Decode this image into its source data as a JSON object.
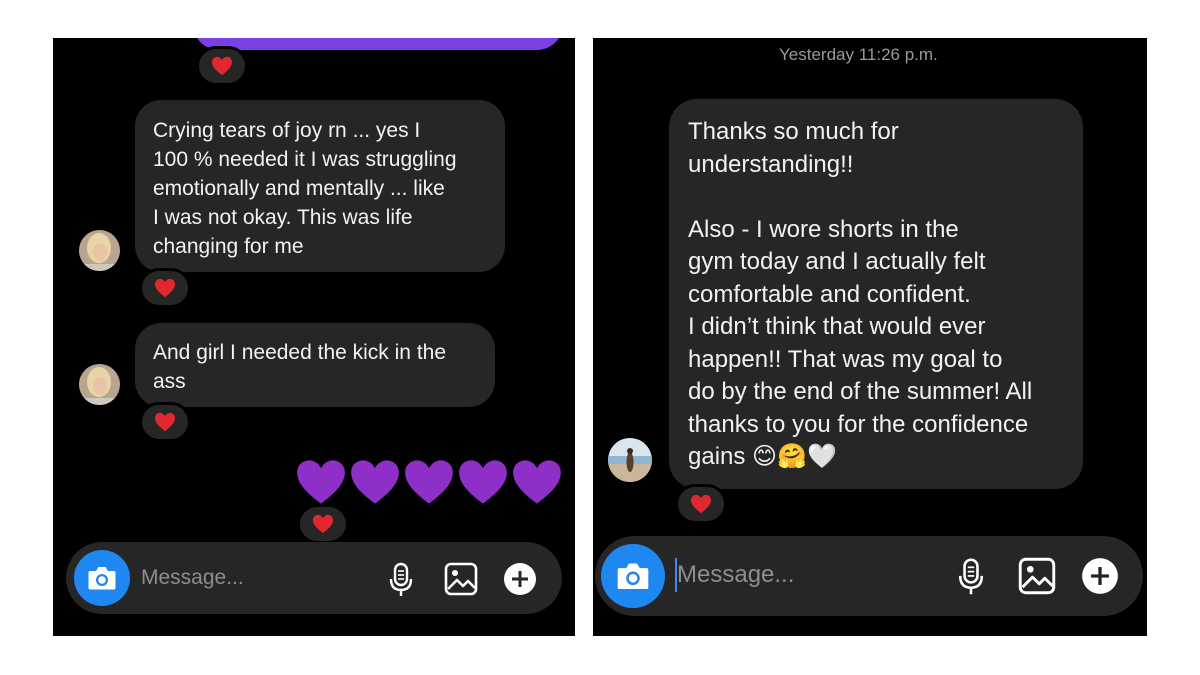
{
  "left": {
    "messages": [
      {
        "text": "Crying tears of joy rn ... yes I\n100 % needed it I was struggling\nemotionally and mentally ... like\nI was not okay. This was life\nchanging for me"
      },
      {
        "text": "And girl I needed the kick in the\nass"
      }
    ],
    "composer": {
      "placeholder": "Message..."
    }
  },
  "right": {
    "timestamp": "Yesterday 11:26 p.m.",
    "message": {
      "text": "Thanks so much for\nunderstanding!!\n\nAlso - I wore shorts in the\ngym today and I actually felt\ncomfortable and confident.\nI didn’t think that would ever\nhappen!! That was my goal to\ndo by the end of the summer! All\nthanks to you for the confidence\ngains 😊🤗🤍"
    },
    "composer": {
      "placeholder": "Message..."
    }
  },
  "colors": {
    "background": "#000000",
    "bubble": "#262626",
    "sent_bubble": "#7b3fe4",
    "accent": "#1e88f0",
    "heart_reaction": "#e0282e",
    "purple_heart": "#8e2fc8"
  },
  "icons": [
    "heart-icon",
    "purple-heart-icon",
    "camera-icon",
    "microphone-icon",
    "gallery-icon",
    "plus-icon"
  ]
}
